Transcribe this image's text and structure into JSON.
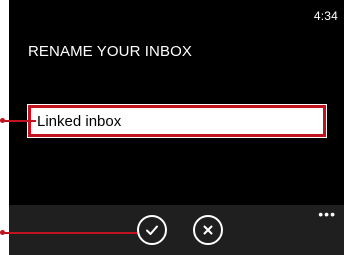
{
  "status": {
    "time": "4:34"
  },
  "page": {
    "title": "RENAME YOUR INBOX"
  },
  "rename": {
    "value": "Linked inbox"
  },
  "app_bar": {
    "buttons": [
      {
        "icon": "check-icon"
      },
      {
        "icon": "close-icon"
      }
    ],
    "more_label": "•••"
  },
  "colors": {
    "accent": "#c1121f",
    "background": "#000000",
    "app_bar": "#1f1f1f"
  }
}
